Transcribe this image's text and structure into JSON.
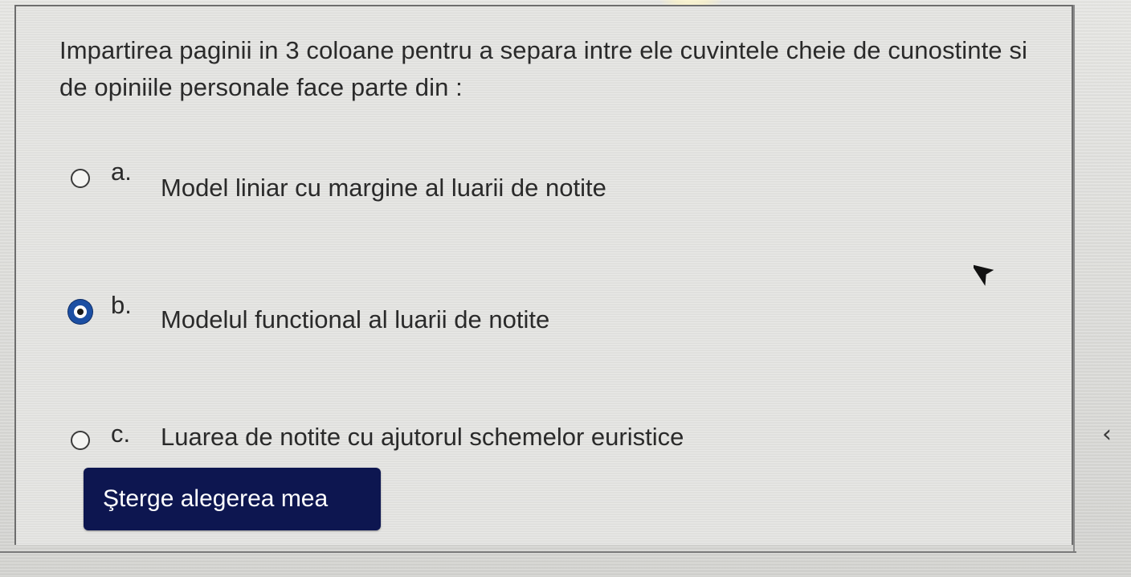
{
  "question": {
    "text": "Impartirea paginii in 3 coloane pentru a separa intre ele cuvintele cheie de cunostinte si de opiniile personale face parte din :"
  },
  "options": [
    {
      "letter": "a.",
      "label": "Model liniar cu margine  al luarii de notite",
      "selected": false
    },
    {
      "letter": "b.",
      "label": "Modelul functional al luarii de notite",
      "selected": true
    },
    {
      "letter": "c.",
      "label": "Luarea de notite cu ajutorul schemelor euristice",
      "selected": false
    }
  ],
  "clear_button": {
    "label": "Şterge alegerea mea"
  },
  "side_nav": {
    "glyph": "‹"
  },
  "colors": {
    "button_bg": "#0d1650",
    "radio_selected": "#1c4fa3",
    "text": "#2a2a2a"
  }
}
